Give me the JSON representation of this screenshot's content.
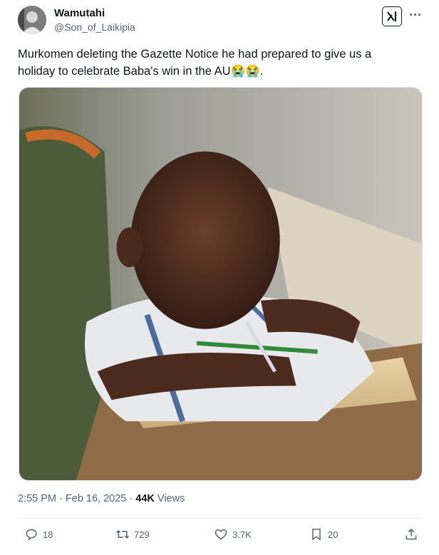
{
  "author": {
    "display_name": "Wamutahi",
    "handle": "@Son_of_Laikipia"
  },
  "tweet": {
    "text_line1": "Murkomen deleting the Gazette Notice he had prepared to give us a",
    "text_line2_prefix": "holiday to celebrate Baba's win in the AU",
    "text_line2_emoji": "😭😭",
    "text_line2_suffix": "."
  },
  "header_buttons": {
    "grok_icon": "grok-icon",
    "more_icon": "more-dots-icon"
  },
  "media": {
    "description_icon": "photo-child-writing-at-desk"
  },
  "meta": {
    "time": "2:55 PM",
    "separator": "·",
    "date": "Feb 16, 2025",
    "views_count": "44K",
    "views_label": "Views"
  },
  "actions": {
    "replies": "18",
    "reposts": "729",
    "likes": "3.7K",
    "bookmarks": "20"
  },
  "colors": {
    "text": "#0f1419",
    "secondary": "#536471",
    "divider": "#e6ecf0"
  }
}
